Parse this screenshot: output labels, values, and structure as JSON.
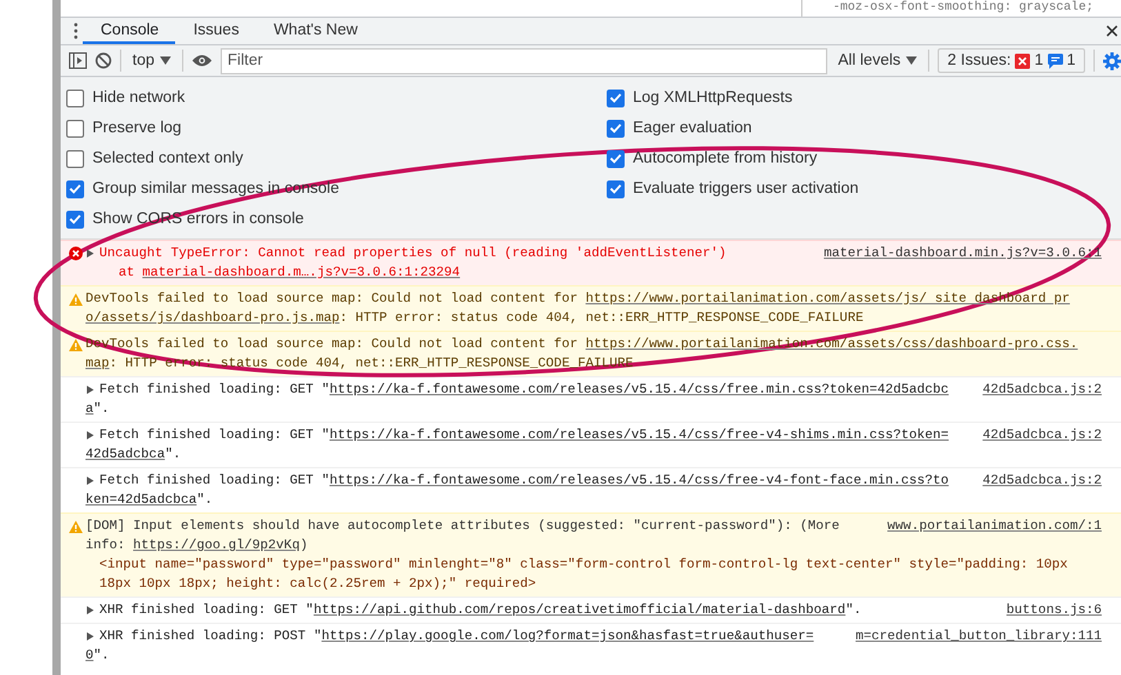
{
  "page_behind": {
    "code_text": "-moz-osx-font-smoothing: grayscale;"
  },
  "tabs": [
    {
      "label": "Console",
      "selected": true
    },
    {
      "label": "Issues",
      "selected": false
    },
    {
      "label": "What's New",
      "selected": false
    }
  ],
  "toolbar": {
    "context": "top",
    "filter": {
      "placeholder": "Filter"
    },
    "levels": "All levels",
    "issues": {
      "label": "2 Issues:",
      "errors": "1",
      "infos": "1"
    }
  },
  "settings": {
    "left": [
      {
        "label": "Hide network",
        "checked": false
      },
      {
        "label": "Preserve log",
        "checked": false
      },
      {
        "label": "Selected context only",
        "checked": false
      },
      {
        "label": "Group similar messages in console",
        "checked": true
      },
      {
        "label": "Show CORS errors in console",
        "checked": true
      }
    ],
    "right": [
      {
        "label": "Log XMLHttpRequests",
        "checked": true
      },
      {
        "label": "Eager evaluation",
        "checked": true
      },
      {
        "label": "Autocomplete from history",
        "checked": true
      },
      {
        "label": "Evaluate triggers user activation",
        "checked": true
      }
    ]
  },
  "messages": [
    {
      "kind": "error",
      "expandable": true,
      "lines": [
        {
          "kind": "main",
          "parts": [
            {
              "kind": "text",
              "text": "Uncaught TypeError: Cannot read properties of null (reading 'addEventListener')"
            }
          ]
        },
        {
          "kind": "detail",
          "parts": [
            {
              "kind": "text",
              "text": "at "
            },
            {
              "kind": "link",
              "text": "material-dashboard.m….js?v=3.0.6:1:23294"
            }
          ]
        }
      ],
      "source": "material-dashboard.min.js?v=3.0.6:1"
    },
    {
      "kind": "warning",
      "expandable": false,
      "lines": [
        {
          "kind": "main",
          "parts": [
            {
              "kind": "text",
              "text": "DevTools failed to load source map: Could not load content for "
            },
            {
              "kind": "link",
              "text": "https://www.portailanimation.com/assets/js/ site dashboard pr"
            }
          ]
        },
        {
          "kind": "main",
          "parts": [
            {
              "kind": "link",
              "text": "o/assets/js/dashboard-pro.js.map"
            },
            {
              "kind": "text",
              "text": ": HTTP error: status code 404, net::ERR_HTTP_RESPONSE_CODE_FAILURE"
            }
          ]
        }
      ]
    },
    {
      "kind": "warning",
      "expandable": false,
      "lines": [
        {
          "kind": "main",
          "parts": [
            {
              "kind": "text",
              "text": "DevTools failed to load source map: Could not load content for "
            },
            {
              "kind": "link",
              "text": "https://www.portailanimation.com/assets/css/dashboard-pro.css."
            }
          ]
        },
        {
          "kind": "main",
          "parts": [
            {
              "kind": "link",
              "text": "map"
            },
            {
              "kind": "text",
              "text": ": HTTP error: status code 404, net::ERR_HTTP_RESPONSE_CODE_FAILURE"
            }
          ]
        }
      ]
    },
    {
      "kind": "info",
      "expandable": true,
      "lines": [
        {
          "kind": "main",
          "parts": [
            {
              "kind": "text",
              "text": "Fetch finished loading: GET \""
            },
            {
              "kind": "link",
              "text": "https://ka-f.fontawesome.com/releases/v5.15.4/css/free.min.css?token=42d5adcbc"
            }
          ]
        },
        {
          "kind": "main",
          "parts": [
            {
              "kind": "link",
              "text": "a"
            },
            {
              "kind": "text",
              "text": "\"."
            }
          ]
        }
      ],
      "source": "42d5adcbca.js:2"
    },
    {
      "kind": "info",
      "expandable": true,
      "lines": [
        {
          "kind": "main",
          "parts": [
            {
              "kind": "text",
              "text": "Fetch finished loading: GET \""
            },
            {
              "kind": "link",
              "text": "https://ka-f.fontawesome.com/releases/v5.15.4/css/free-v4-shims.min.css?token="
            }
          ]
        },
        {
          "kind": "main",
          "parts": [
            {
              "kind": "link",
              "text": "42d5adcbca"
            },
            {
              "kind": "text",
              "text": "\"."
            }
          ]
        }
      ],
      "source": "42d5adcbca.js:2"
    },
    {
      "kind": "info",
      "expandable": true,
      "lines": [
        {
          "kind": "main",
          "parts": [
            {
              "kind": "text",
              "text": "Fetch finished loading: GET \""
            },
            {
              "kind": "link",
              "text": "https://ka-f.fontawesome.com/releases/v5.15.4/css/free-v4-font-face.min.css?to"
            }
          ]
        },
        {
          "kind": "main",
          "parts": [
            {
              "kind": "link",
              "text": "ken=42d5adcbca"
            },
            {
              "kind": "text",
              "text": "\"."
            }
          ]
        }
      ],
      "source": "42d5adcbca.js:2"
    },
    {
      "kind": "dom",
      "expandable": false,
      "lines": [
        {
          "kind": "main",
          "parts": [
            {
              "kind": "text",
              "text": "[DOM] Input elements should have autocomplete attributes (suggested: \"current-password\"): (More"
            }
          ]
        },
        {
          "kind": "main",
          "parts": [
            {
              "kind": "text",
              "text": "info: "
            },
            {
              "kind": "link",
              "text": "https://goo.gl/9p2vKq"
            },
            {
              "kind": "text",
              "text": ")"
            }
          ]
        },
        {
          "kind": "code",
          "parts": [
            {
              "kind": "text",
              "text": "<input name=\"password\" type=\"password\" minlenght=\"8\" class=\"form-control form-control-lg text-center\" style=\"padding: 10px"
            }
          ]
        },
        {
          "kind": "code",
          "parts": [
            {
              "kind": "text",
              "text": "18px 10px 18px; height: calc(2.25rem + 2px);\" required>"
            }
          ]
        }
      ],
      "source": "www.portailanimation.com/:1"
    },
    {
      "kind": "info",
      "expandable": true,
      "lines": [
        {
          "kind": "main",
          "parts": [
            {
              "kind": "text",
              "text": "XHR finished loading: GET \""
            },
            {
              "kind": "link",
              "text": "https://api.github.com/repos/creativetimofficial/material-dashboard"
            },
            {
              "kind": "text",
              "text": "\"."
            }
          ]
        }
      ],
      "source": "buttons.js:6"
    },
    {
      "kind": "info",
      "expandable": true,
      "lines": [
        {
          "kind": "main",
          "parts": [
            {
              "kind": "text",
              "text": "XHR finished loading: POST \""
            },
            {
              "kind": "link",
              "text": "https://play.google.com/log?format=json&hasfast=true&authuser="
            }
          ]
        },
        {
          "kind": "main",
          "parts": [
            {
              "kind": "link",
              "text": "0"
            },
            {
              "kind": "text",
              "text": "\"."
            }
          ]
        }
      ],
      "source": "m=credential_button_library:111"
    }
  ],
  "annotation": {
    "kind": "ellipse",
    "color": "#c8105a"
  }
}
